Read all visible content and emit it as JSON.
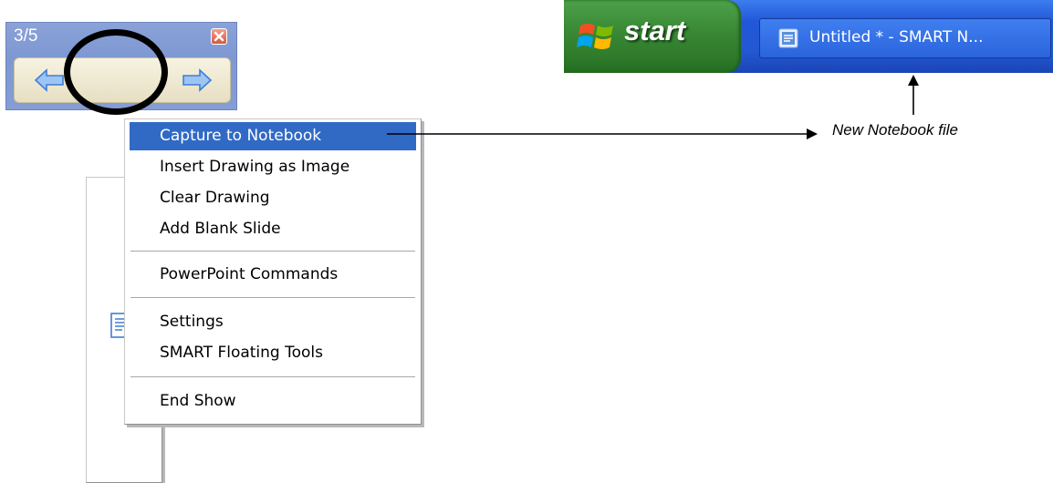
{
  "slide_toolbar": {
    "slide_counter": "3/5",
    "buttons": [
      {
        "name": "previous-slide",
        "icon": "arrow-left-icon"
      },
      {
        "name": "menu",
        "icon": "document-down-icon"
      },
      {
        "name": "next-slide",
        "icon": "arrow-right-icon"
      }
    ],
    "close_icon": "close-icon"
  },
  "context_menu": {
    "items": [
      {
        "label": "Capture to Notebook",
        "selected": true
      },
      {
        "label": "Insert Drawing as Image"
      },
      {
        "label": "Clear Drawing"
      },
      {
        "label": "Add Blank Slide"
      },
      {
        "label": "PowerPoint Commands"
      },
      {
        "label": "Settings"
      },
      {
        "label": "SMART Floating Tools"
      },
      {
        "label": "End Show"
      }
    ]
  },
  "taskbar": {
    "start_label": "start",
    "task_title": "Untitled * - SMART N..."
  },
  "annotation": {
    "label": "New Notebook file"
  },
  "colors": {
    "menu_highlight": "#316ac5",
    "taskbar_blue": "#2458d2",
    "start_green": "#3a8a36",
    "toolbar_blue": "#8aa2d8"
  }
}
